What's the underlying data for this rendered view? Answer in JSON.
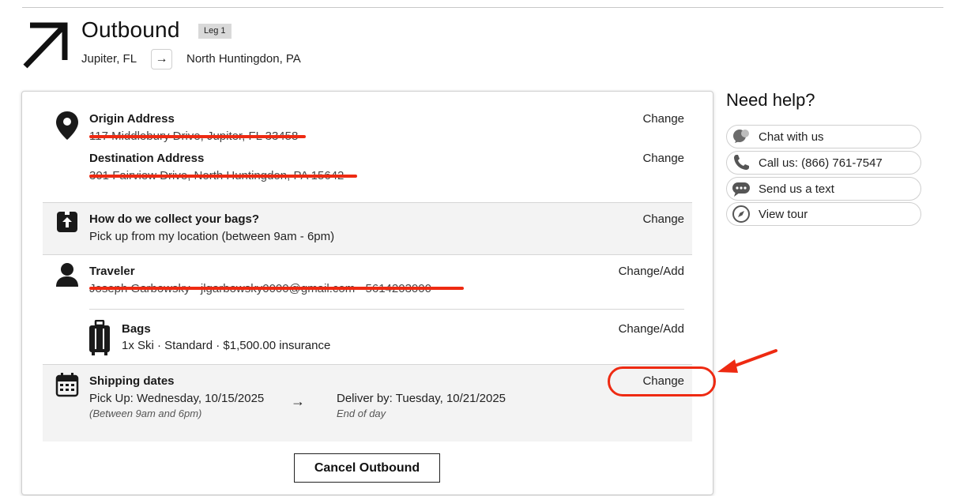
{
  "header": {
    "title": "Outbound",
    "leg_badge": "Leg 1",
    "from": "Jupiter, FL",
    "route_arrow": "→",
    "to": "North Huntingdon, PA"
  },
  "sections": {
    "origin": {
      "label": "Origin Address",
      "value": "117 Middlebury Drive, Jupiter, FL 33458",
      "change": "Change",
      "icon": "location-pin-icon"
    },
    "destination": {
      "label": "Destination Address",
      "value": "301 Fairview Drive, North Huntingdon, PA 15642",
      "change": "Change"
    },
    "collect": {
      "label": "How do we collect your bags?",
      "value": "Pick up from my location (between 9am - 6pm)",
      "change": "Change",
      "icon": "pickup-box-icon"
    },
    "traveler": {
      "label": "Traveler",
      "value": "Joseph Garbowsky · jlgarbowsky0000@gmail.com · 5614203000",
      "change": "Change/Add",
      "icon": "person-icon"
    },
    "bags": {
      "label": "Bags",
      "value": "1x Ski · Standard · $1,500.00 insurance",
      "change": "Change/Add",
      "icon": "luggage-icon"
    },
    "shipping": {
      "label": "Shipping dates",
      "pickup": "Pick Up: Wednesday, 10/15/2025",
      "pickup_note": "(Between 9am and 6pm)",
      "arrow": "→",
      "deliver": "Deliver by: Tuesday, 10/21/2025",
      "deliver_note": "End of day",
      "change": "Change",
      "icon": "calendar-icon"
    }
  },
  "cancel_button": "Cancel Outbound",
  "help": {
    "title": "Need help?",
    "items": [
      {
        "label": "Chat with us",
        "icon": "chat-bubble-icon"
      },
      {
        "label": "Call us: (866) 761-7547",
        "icon": "phone-icon"
      },
      {
        "label": "Send us a text",
        "icon": "text-message-icon"
      },
      {
        "label": "View tour",
        "icon": "compass-icon"
      }
    ]
  },
  "colors": {
    "annotation_red": "#ee2a12",
    "band_gray": "#f3f3f3",
    "text_dark": "#1a1a1a"
  }
}
